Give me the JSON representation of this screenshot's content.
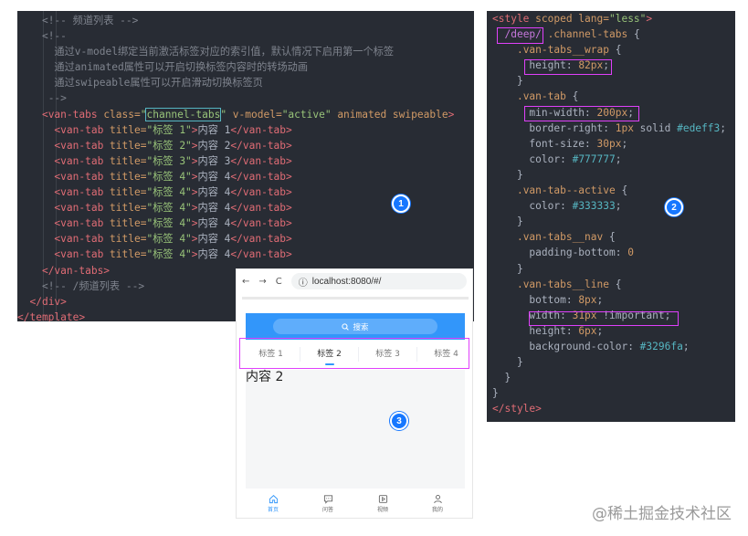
{
  "panel1": {
    "lines": [
      {
        "indent": "    ",
        "parts": [
          [
            "c-comment",
            "<!-- 频道列表 -->"
          ]
        ]
      },
      {
        "indent": "    ",
        "parts": [
          [
            "c-comment",
            "<!--"
          ]
        ]
      },
      {
        "indent": "      ",
        "parts": [
          [
            "c-comment",
            "通过v-model绑定当前激活标签对应的索引值，默认情况下启用第一个标签"
          ]
        ]
      },
      {
        "indent": "      ",
        "parts": [
          [
            "c-comment",
            "通过animated属性可以开启切换标签内容时的转场动画"
          ]
        ]
      },
      {
        "indent": "      ",
        "parts": [
          [
            "c-comment",
            "通过swipeable属性可以开启滑动切换标签页"
          ]
        ]
      },
      {
        "indent": "     ",
        "parts": [
          [
            "c-comment",
            "-->"
          ]
        ]
      },
      {
        "indent": "    ",
        "parts": [
          [
            "c-tag",
            "<van-tabs "
          ],
          [
            "c-attr",
            "class="
          ],
          [
            "c-str",
            "\""
          ],
          [
            "c-str hl-word",
            "channel-tabs"
          ],
          [
            "c-str",
            "\""
          ],
          [
            "c-attr",
            " v-model="
          ],
          [
            "c-str",
            "\"active\""
          ],
          [
            "c-attr",
            " animated swipeable"
          ],
          [
            "c-tag",
            ">"
          ]
        ]
      },
      {
        "indent": "      ",
        "parts": [
          [
            "c-tag",
            "<van-tab "
          ],
          [
            "c-attr",
            "title="
          ],
          [
            "c-str",
            "\"标签 1\""
          ],
          [
            "c-tag",
            ">"
          ],
          [
            "c-txt",
            "内容 1"
          ],
          [
            "c-tag",
            "</van-tab>"
          ]
        ]
      },
      {
        "indent": "      ",
        "parts": [
          [
            "c-tag",
            "<van-tab "
          ],
          [
            "c-attr",
            "title="
          ],
          [
            "c-str",
            "\"标签 2\""
          ],
          [
            "c-tag",
            ">"
          ],
          [
            "c-txt",
            "内容 2"
          ],
          [
            "c-tag",
            "</van-tab>"
          ]
        ]
      },
      {
        "indent": "      ",
        "parts": [
          [
            "c-tag",
            "<van-tab "
          ],
          [
            "c-attr",
            "title="
          ],
          [
            "c-str",
            "\"标签 3\""
          ],
          [
            "c-tag",
            ">"
          ],
          [
            "c-txt",
            "内容 3"
          ],
          [
            "c-tag",
            "</van-tab>"
          ]
        ]
      },
      {
        "indent": "      ",
        "parts": [
          [
            "c-tag",
            "<van-tab "
          ],
          [
            "c-attr",
            "title="
          ],
          [
            "c-str",
            "\"标签 4\""
          ],
          [
            "c-tag",
            ">"
          ],
          [
            "c-txt",
            "内容 4"
          ],
          [
            "c-tag",
            "</van-tab>"
          ]
        ]
      },
      {
        "indent": "      ",
        "parts": [
          [
            "c-tag",
            "<van-tab "
          ],
          [
            "c-attr",
            "title="
          ],
          [
            "c-str",
            "\"标签 4\""
          ],
          [
            "c-tag",
            ">"
          ],
          [
            "c-txt",
            "内容 4"
          ],
          [
            "c-tag",
            "</van-tab>"
          ]
        ]
      },
      {
        "indent": "      ",
        "parts": [
          [
            "c-tag",
            "<van-tab "
          ],
          [
            "c-attr",
            "title="
          ],
          [
            "c-str",
            "\"标签 4\""
          ],
          [
            "c-tag",
            ">"
          ],
          [
            "c-txt",
            "内容 4"
          ],
          [
            "c-tag",
            "</van-tab>"
          ]
        ]
      },
      {
        "indent": "      ",
        "parts": [
          [
            "c-tag",
            "<van-tab "
          ],
          [
            "c-attr",
            "title="
          ],
          [
            "c-str",
            "\"标签 4\""
          ],
          [
            "c-tag",
            ">"
          ],
          [
            "c-txt",
            "内容 4"
          ],
          [
            "c-tag",
            "</van-tab>"
          ]
        ]
      },
      {
        "indent": "      ",
        "parts": [
          [
            "c-tag",
            "<van-tab "
          ],
          [
            "c-attr",
            "title="
          ],
          [
            "c-str",
            "\"标签 4\""
          ],
          [
            "c-tag",
            ">"
          ],
          [
            "c-txt",
            "内容 4"
          ],
          [
            "c-tag",
            "</van-tab>"
          ]
        ]
      },
      {
        "indent": "      ",
        "parts": [
          [
            "c-tag",
            "<van-tab "
          ],
          [
            "c-attr",
            "title="
          ],
          [
            "c-str",
            "\"标签 4\""
          ],
          [
            "c-tag",
            ">"
          ],
          [
            "c-txt",
            "内容 4"
          ],
          [
            "c-tag",
            "</van-tab>"
          ]
        ]
      },
      {
        "indent": "    ",
        "parts": [
          [
            "c-tag",
            "</van-tabs>"
          ]
        ]
      },
      {
        "indent": "    ",
        "parts": [
          [
            "c-comment",
            "<!-- /频道列表 -->"
          ]
        ]
      },
      {
        "indent": "  ",
        "parts": [
          [
            "c-tag",
            "</div>"
          ]
        ]
      },
      {
        "indent": "",
        "parts": [
          [
            "c-tag",
            "</template>"
          ]
        ]
      }
    ]
  },
  "panel2": {
    "lines": [
      {
        "indent": "",
        "parts": [
          [
            "c-tag",
            "<style "
          ],
          [
            "c-attr",
            "scoped lang="
          ],
          [
            "c-str",
            "\"less\""
          ],
          [
            "c-tag",
            ">"
          ]
        ]
      },
      {
        "indent": "  ",
        "parts": [
          [
            "c-kw",
            "/deep/"
          ],
          [
            "c-sel",
            " .channel-tabs"
          ],
          [
            "c-prop",
            " {"
          ]
        ]
      },
      {
        "indent": "    ",
        "parts": [
          [
            "c-sel",
            ".van-tabs__wrap"
          ],
          [
            "c-prop",
            " {"
          ]
        ]
      },
      {
        "indent": "      ",
        "parts": [
          [
            "c-prop",
            "height: "
          ],
          [
            "c-num",
            "82px"
          ],
          [
            "c-prop",
            ";"
          ]
        ]
      },
      {
        "indent": "    ",
        "parts": [
          [
            "c-prop",
            "}"
          ]
        ]
      },
      {
        "indent": "    ",
        "parts": [
          [
            "c-sel",
            ".van-tab"
          ],
          [
            "c-prop",
            " {"
          ]
        ]
      },
      {
        "indent": "      ",
        "parts": [
          [
            "c-prop",
            "min-width: "
          ],
          [
            "c-num",
            "200px"
          ],
          [
            "c-prop",
            ";"
          ]
        ]
      },
      {
        "indent": "      ",
        "parts": [
          [
            "c-prop",
            "border-right: "
          ],
          [
            "c-num",
            "1px"
          ],
          [
            "c-prop",
            " solid "
          ],
          [
            "c-hex",
            "#edeff3"
          ],
          [
            "c-prop",
            ";"
          ]
        ]
      },
      {
        "indent": "      ",
        "parts": [
          [
            "c-prop",
            "font-size: "
          ],
          [
            "c-num",
            "30px"
          ],
          [
            "c-prop",
            ";"
          ]
        ]
      },
      {
        "indent": "      ",
        "parts": [
          [
            "c-prop",
            "color: "
          ],
          [
            "c-hex",
            "#777777"
          ],
          [
            "c-prop",
            ";"
          ]
        ]
      },
      {
        "indent": "    ",
        "parts": [
          [
            "c-prop",
            "}"
          ]
        ]
      },
      {
        "indent": "    ",
        "parts": [
          [
            "c-sel",
            ".van-tab--active"
          ],
          [
            "c-prop",
            " {"
          ]
        ]
      },
      {
        "indent": "      ",
        "parts": [
          [
            "c-prop",
            "color: "
          ],
          [
            "c-hex",
            "#333333"
          ],
          [
            "c-prop",
            ";"
          ]
        ]
      },
      {
        "indent": "    ",
        "parts": [
          [
            "c-prop",
            "}"
          ]
        ]
      },
      {
        "indent": "    ",
        "parts": [
          [
            "c-sel",
            ".van-tabs__nav"
          ],
          [
            "c-prop",
            " {"
          ]
        ]
      },
      {
        "indent": "      ",
        "parts": [
          [
            "c-prop",
            "padding-bottom: "
          ],
          [
            "c-num",
            "0"
          ]
        ]
      },
      {
        "indent": "    ",
        "parts": [
          [
            "c-prop",
            "}"
          ]
        ]
      },
      {
        "indent": "    ",
        "parts": [
          [
            "c-sel",
            ".van-tabs__line"
          ],
          [
            "c-prop",
            " {"
          ]
        ]
      },
      {
        "indent": "      ",
        "parts": [
          [
            "c-prop",
            "bottom: "
          ],
          [
            "c-num",
            "8px"
          ],
          [
            "c-prop",
            ";"
          ]
        ]
      },
      {
        "indent": "      ",
        "parts": [
          [
            "c-prop",
            "width: "
          ],
          [
            "c-num",
            "31px"
          ],
          [
            "c-prop",
            " !important;"
          ]
        ]
      },
      {
        "indent": "      ",
        "parts": [
          [
            "c-prop",
            "height: "
          ],
          [
            "c-num",
            "6px"
          ],
          [
            "c-prop",
            ";"
          ]
        ]
      },
      {
        "indent": "      ",
        "parts": [
          [
            "c-prop",
            "background-color: "
          ],
          [
            "c-hex",
            "#3296fa"
          ],
          [
            "c-prop",
            ";"
          ]
        ]
      },
      {
        "indent": "    ",
        "parts": [
          [
            "c-prop",
            "}"
          ]
        ]
      },
      {
        "indent": "  ",
        "parts": [
          [
            "c-prop",
            "}"
          ]
        ]
      },
      {
        "indent": "",
        "parts": [
          [
            "c-prop",
            "}"
          ]
        ]
      },
      {
        "indent": "",
        "parts": [
          [
            "c-tag",
            "</style>"
          ]
        ]
      }
    ]
  },
  "browser": {
    "url": "localhost:8080/#/",
    "search_label": "搜索",
    "tabs": [
      "标签 1",
      "标签 2",
      "标签 3",
      "标签 4"
    ],
    "active_tab_index": 1,
    "content": "内容 2",
    "tabbar": [
      "首页",
      "问答",
      "视频",
      "我的"
    ]
  },
  "badges": {
    "one": "1",
    "two": "2",
    "three": "3"
  },
  "watermark": "@稀土掘金技术社区",
  "colors": {
    "accent": "#3296fa",
    "highlight": "#e040fb",
    "badge": "#1677ff"
  }
}
